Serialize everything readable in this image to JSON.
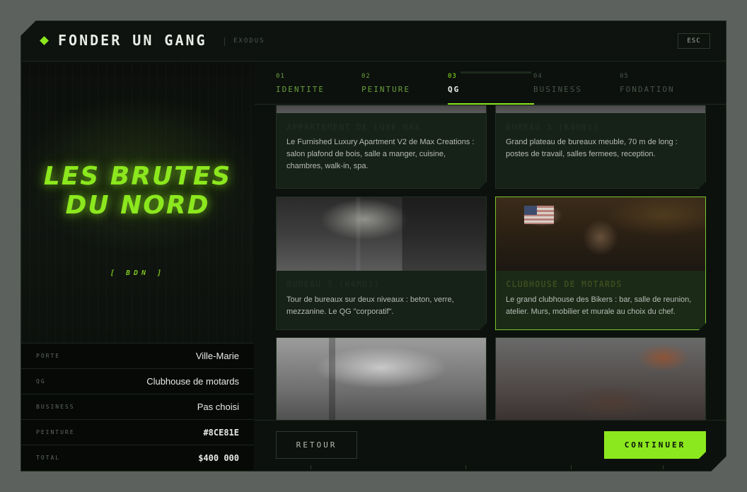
{
  "header": {
    "title": "FONDER UN GANG",
    "subtitle": "EXODUS",
    "esc_label": "ESC"
  },
  "preview": {
    "name_line1": "LES BRUTES",
    "name_line2": "DU NORD",
    "tag": "[ BDN ]"
  },
  "summary": [
    {
      "key": "PORTE",
      "value": "Ville-Marie"
    },
    {
      "key": "QG",
      "value": "Clubhouse de motards"
    },
    {
      "key": "BUSINESS",
      "value": "Pas choisi"
    },
    {
      "key": "PEINTURE",
      "value": "#8CE81E"
    },
    {
      "key": "TOTAL",
      "value": "$400 000"
    }
  ],
  "tabs": [
    {
      "num": "01",
      "label": "IDENTITE",
      "state": "done"
    },
    {
      "num": "02",
      "label": "PEINTURE",
      "state": "done"
    },
    {
      "num": "03",
      "label": "QG",
      "state": "active"
    },
    {
      "num": "04",
      "label": "BUSINESS",
      "state": "future"
    },
    {
      "num": "05",
      "label": "FONDATION",
      "state": "future"
    }
  ],
  "cards": [
    {
      "title": "APPARTEMENT DE LUXE MAX",
      "desc": "Le Furnished Luxury Apartment V2 de Max Creations : salon plafond de bois, salle a manger, cuisine, chambres, walk-in, spa.",
      "selected": false
    },
    {
      "title": "BUREAU 3 (K4MB1)",
      "desc": "Grand plateau de bureaux meuble, 70 m de long : postes de travail, salles fermees, reception.",
      "selected": false
    },
    {
      "title": "BUREAU 5 (K4MB1)",
      "desc": "Tour de bureaux sur deux niveaux : beton, verre, mezzanine. Le QG \"corporatif\".",
      "selected": false
    },
    {
      "title": "CLUBHOUSE DE MOTARDS",
      "desc": "Le grand clubhouse des Bikers : bar, salle de reunion, atelier. Murs, mobilier et murale au choix du chef.",
      "selected": true
    },
    {
      "title": "",
      "desc": "",
      "selected": false
    },
    {
      "title": "",
      "desc": "",
      "selected": false
    }
  ],
  "footer": {
    "back_label": "RETOUR",
    "continue_label": "CONTINUER"
  },
  "colors": {
    "accent": "#8CE81E",
    "panel_bg": "#0c110d"
  }
}
